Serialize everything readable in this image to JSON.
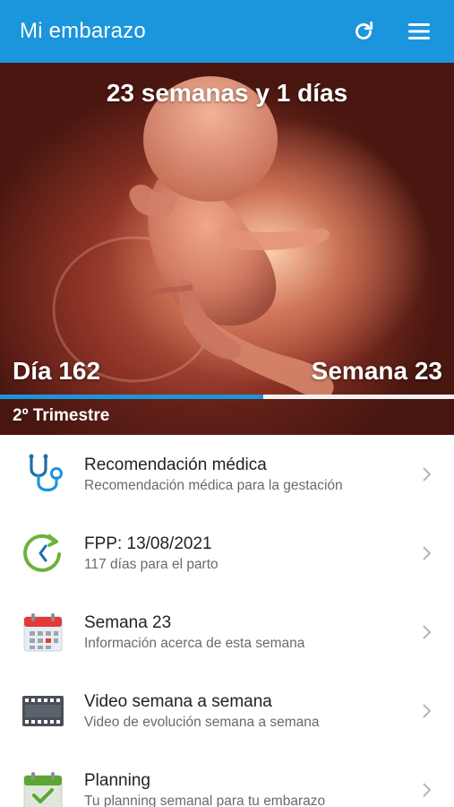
{
  "appbar": {
    "title": "Mi embarazo",
    "icons": [
      "refresh-icon",
      "menu-icon"
    ]
  },
  "hero": {
    "headline": "23 semanas y 1 días",
    "day": "Día 162",
    "week": "Semana 23",
    "trimester": "2º Trimestre",
    "progress_percent": 58,
    "colors": {
      "progress_fill": "#1b95dc",
      "progress_track": "#f2f2f2"
    }
  },
  "menu": {
    "items": [
      {
        "title": "Recomendación médica",
        "subtitle": "Recomendación médica para la gestación",
        "icon": "stethoscope-icon"
      },
      {
        "title": "FPP: 13/08/2021",
        "subtitle": "117 días para el parto",
        "icon": "clock-arrow-icon"
      },
      {
        "title": "Semana 23",
        "subtitle": "Información acerca de esta semana",
        "icon": "calendar-icon"
      },
      {
        "title": "Video semana a semana",
        "subtitle": "Video de evolución semana a semana",
        "icon": "film-icon"
      },
      {
        "title": "Planning",
        "subtitle": "Tu planning semanal para tu embarazo",
        "icon": "calendar-check-icon"
      }
    ]
  },
  "colors": {
    "accent": "#1b95dc"
  }
}
